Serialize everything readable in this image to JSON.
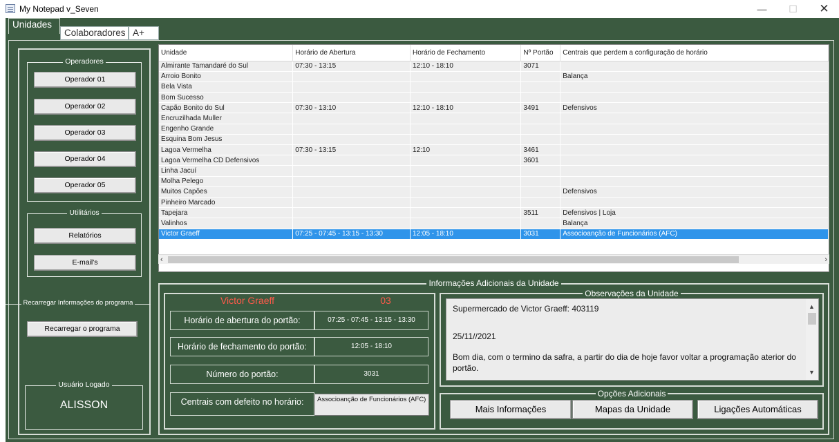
{
  "window": {
    "title": "My Notepad v_Seven"
  },
  "tabs": [
    {
      "label": "Unidades",
      "active": true
    },
    {
      "label": "Colaboradores",
      "active": false
    },
    {
      "label": "A+",
      "active": false
    }
  ],
  "sidebar": {
    "operators_title": "Operadores",
    "operators": [
      "Operador 01",
      "Operador 02",
      "Operador 03",
      "Operador 04",
      "Operador 05"
    ],
    "utilities_title": "Utilitários",
    "utilities": [
      "Relatórios",
      "E-mail's"
    ],
    "reload_title": "Recarregar Informações do programa",
    "reload_button": "Recarregar o programa",
    "user_title": "Usuário Logado",
    "user_name": "ALISSON"
  },
  "grid": {
    "columns": [
      "Unidade",
      "Horário de Abertura",
      "Horário de Fechamento",
      "Nº Portão",
      "Centrais que perdem a configuração de horário"
    ],
    "rows": [
      [
        "Almirante Tamandaré do Sul",
        "07:30 - 13:15",
        "12:10 - 18:10",
        "3071",
        ""
      ],
      [
        "Arroio Bonito",
        "",
        "",
        "",
        "Balança"
      ],
      [
        "Bela Vista",
        "",
        "",
        "",
        ""
      ],
      [
        "Bom Sucesso",
        "",
        "",
        "",
        ""
      ],
      [
        "Capão Bonito do Sul",
        "07:30 - 13:10",
        "12:10 - 18:10",
        "3491",
        "Defensivos"
      ],
      [
        "Encruzilhada Muller",
        "",
        "",
        "",
        ""
      ],
      [
        "Engenho Grande",
        "",
        "",
        "",
        ""
      ],
      [
        "Esquina Bom Jesus",
        "",
        "",
        "",
        ""
      ],
      [
        "Lagoa Vermelha",
        "07:30 - 13:15",
        "12:10",
        "3461",
        ""
      ],
      [
        "Lagoa Vermelha CD Defensivos",
        "",
        "",
        "3601",
        ""
      ],
      [
        "Linha Jacuí",
        "",
        "",
        "",
        ""
      ],
      [
        "Molha Pelego",
        "",
        "",
        "",
        ""
      ],
      [
        "Muitos Capões",
        "",
        "",
        "",
        "Defensivos"
      ],
      [
        "Pinheiro Marcado",
        "",
        "",
        "",
        ""
      ],
      [
        "Tapejara",
        "",
        "",
        "3511",
        "Defensivos | Loja"
      ],
      [
        "Valinhos",
        "",
        "",
        "",
        "Balança"
      ],
      [
        "Victor Graeff",
        "07:25 - 07:45 - 13:15 - 13:30",
        "12:05 - 18:10",
        "3031",
        "Associoanção de Funcionários (AFC)"
      ]
    ],
    "selected_row": 16
  },
  "info": {
    "title": "Informações Adicionais da Unidade",
    "unit_name": "Victor Graeff",
    "unit_code": "03",
    "opening_label": "Horário de abertura do portão:",
    "opening_value": "07:25 - 07:45 - 13:15 - 13:30",
    "closing_label": "Horário de fechamento do portão:",
    "closing_value": "12:05 - 18:10",
    "gate_label": "Número do portão:",
    "gate_value": "3031",
    "defect_label": "Centrais com defeito no horário:",
    "defect_value": "Associoanção de Funcionários (AFC)",
    "highlight_color": "#ff5a4a"
  },
  "observations": {
    "title": "Observações da Unidade",
    "line1": "Supermercado de Victor Graeff: 403119",
    "line2": "25/11//2021",
    "line3": "Bom dia, com o termino da safra, a partir do dia de hoje favor voltar a programação aterior do portão."
  },
  "options": {
    "title": "Opções Adicionais",
    "more_info": "Mais Informações",
    "maps": "Mapas da Unidade",
    "auto_calls": "Ligações Automáticas"
  }
}
